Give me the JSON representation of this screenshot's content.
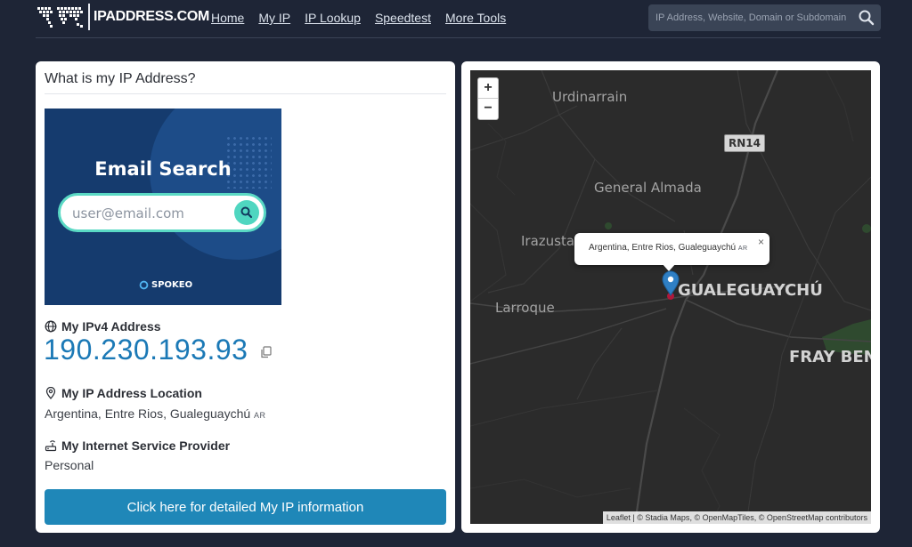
{
  "header": {
    "logo_text": "IPADDRESS.COM",
    "nav": [
      "Home",
      "My IP",
      "IP Lookup",
      "Speedtest",
      "More Tools"
    ],
    "search_placeholder": "IP Address, Website, Domain or Subdomain"
  },
  "card": {
    "title": "What is my IP Address?",
    "ad": {
      "title": "Email Search",
      "placeholder": "user@email.com",
      "brand": "SPOKEO"
    },
    "ipv4_label": "My IPv4 Address",
    "ipv4_value": "190.230.193.93",
    "location_label": "My IP Address Location",
    "location_value": "Argentina, Entre Rios, Gualeguaychú",
    "location_cc": "AR",
    "isp_label": "My Internet Service Provider",
    "isp_value": "Personal",
    "button_label": "Click here for detailed My IP information"
  },
  "map": {
    "zoom_in": "+",
    "zoom_out": "−",
    "places": {
      "urdinarrain": "Urdinarrain",
      "general_almada": "General Almada",
      "irazusta": "Irazusta",
      "larroque": "Larroque",
      "gualeguaychu": "GUALEGUAYCHÚ",
      "fray_bentos": "FRAY BEN"
    },
    "road_shield": "RN14",
    "popup_text": "Argentina, Entre Rios, Gualeguaychú",
    "popup_cc": "AR",
    "popup_close": "×",
    "attribution": {
      "leaflet": "Leaflet",
      "sep1": " | © ",
      "stadia": "Stadia Maps",
      "sep2": ", © ",
      "openmaptiles": "OpenMapTiles",
      "sep3": ", © ",
      "osm": "OpenStreetMap",
      "contributors": " contributors"
    }
  },
  "colors": {
    "page_bg": "#1e2536",
    "accent": "#1f87b8",
    "ip_blue": "#1b79b6",
    "map_bg": "#2b2b2b"
  }
}
